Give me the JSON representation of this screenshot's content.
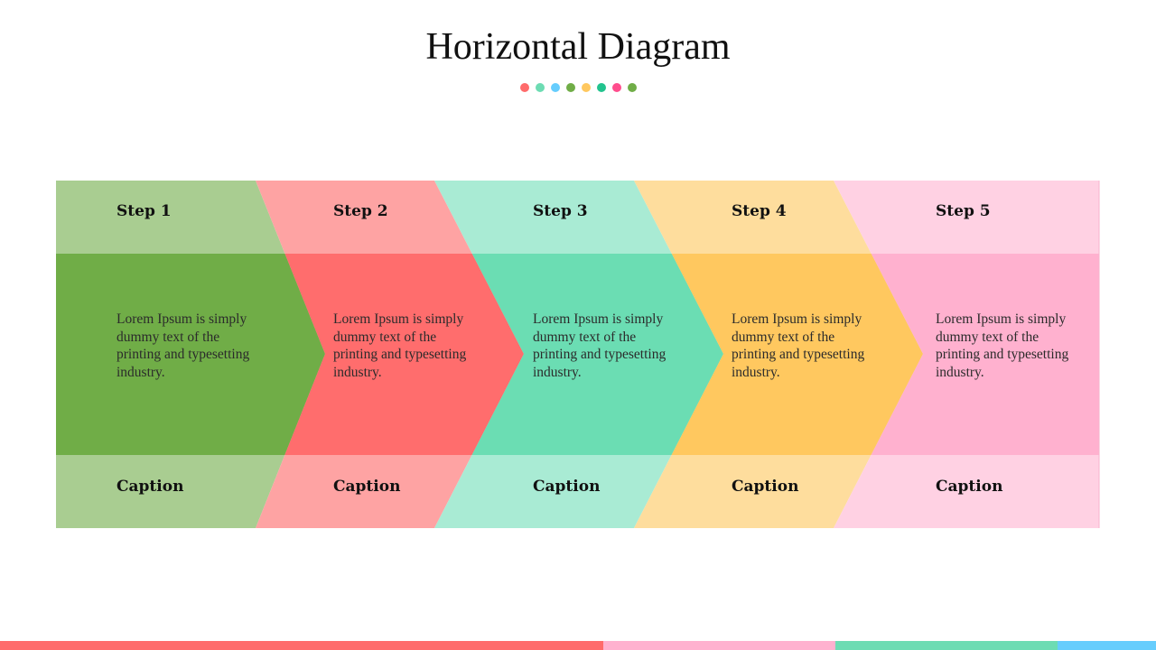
{
  "title": "Horizontal Diagram",
  "title_dots": [
    {
      "color": "#ff6b6b"
    },
    {
      "color": "#6ddcb3"
    },
    {
      "color": "#66cdfd"
    },
    {
      "color": "#70ad47"
    },
    {
      "color": "#ffc85f"
    },
    {
      "color": "#22c38e"
    },
    {
      "color": "#ff4d8d"
    },
    {
      "color": "#70ad47"
    }
  ],
  "steps": [
    {
      "label": "Step 1",
      "text": "Lorem Ipsum is simply dummy text of the printing and typesetting industry.",
      "caption": "Caption",
      "light": "#a9cd91",
      "dark": "#70ad47"
    },
    {
      "label": "Step 2",
      "text": "Lorem Ipsum is simply dummy text of the printing and typesetting industry.",
      "caption": "Caption",
      "light": "#fea3a3",
      "dark": "#ff6d6d"
    },
    {
      "label": "Step 3",
      "text": "Lorem Ipsum is simply dummy text of the printing and typesetting industry.",
      "caption": "Caption",
      "light": "#a9ebd4",
      "dark": "#6bddb3"
    },
    {
      "label": "Step 4",
      "text": "Lorem Ipsum is simply dummy text of the printing and typesetting industry.",
      "caption": "Caption",
      "light": "#fedd9d",
      "dark": "#ffc85f"
    },
    {
      "label": "Step 5",
      "text": "Lorem Ipsum is simply dummy text of the printing and typesetting industry.",
      "caption": "Caption",
      "light": "#ffd1e3",
      "dark": "#ffb1cf"
    }
  ],
  "bottom_bar": [
    {
      "color": "#ff6b6b"
    },
    {
      "color": "#ffb1cf"
    },
    {
      "color": "#6ddcb3"
    },
    {
      "color": "#66cdfd"
    }
  ]
}
